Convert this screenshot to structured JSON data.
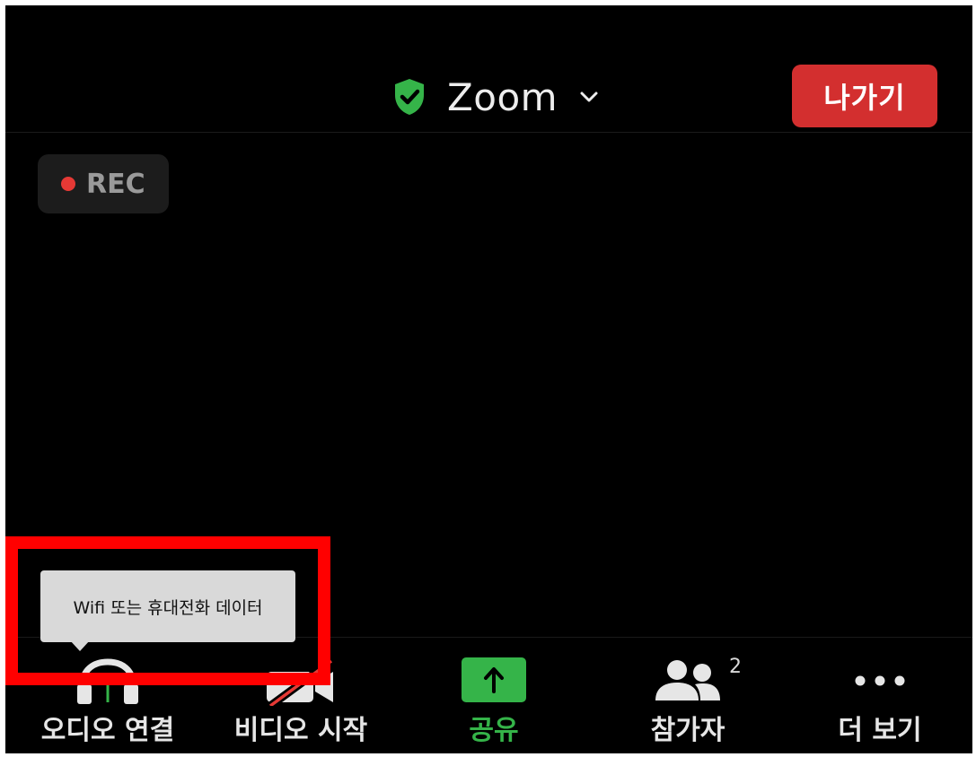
{
  "header": {
    "title": "Zoom",
    "leave_label": "나가기",
    "colors": {
      "shield": "#35b449",
      "leave": "#d32f2f"
    }
  },
  "recording": {
    "label": "REC",
    "dot_color": "#e53935"
  },
  "tooltip": {
    "text": "Wifi 또는 휴대전화 데이터"
  },
  "toolbar": {
    "items": [
      {
        "label": "오디오 연결",
        "icon": "headphones-icon"
      },
      {
        "label": "비디오 시작",
        "icon": "video-off-icon"
      },
      {
        "label": "공유",
        "icon": "share-icon",
        "color": "#35b449"
      },
      {
        "label": "참가자",
        "icon": "participants-icon",
        "badge": "2"
      },
      {
        "label": "더 보기",
        "icon": "more-icon"
      }
    ]
  }
}
